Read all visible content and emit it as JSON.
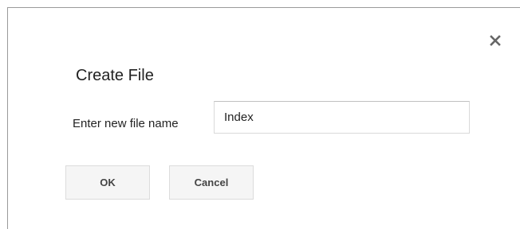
{
  "dialog": {
    "title": "Create File",
    "close_icon": "close-icon",
    "field_label": "Enter new file name",
    "file_name_value": "Index",
    "ok_label": "OK",
    "cancel_label": "Cancel"
  }
}
